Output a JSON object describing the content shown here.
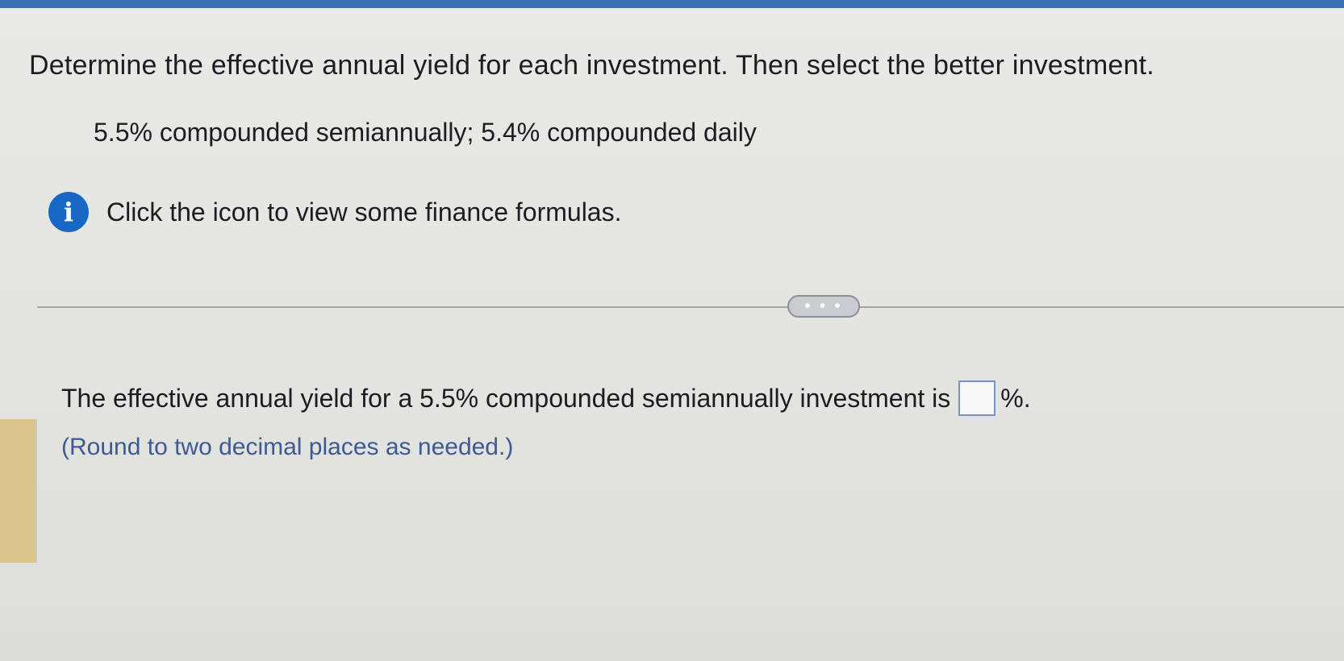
{
  "question": {
    "title": "Determine the effective annual yield for each investment. Then select the better investment.",
    "problem": "5.5% compounded semiannually; 5.4% compounded daily",
    "info_text": "Click the icon to view some finance formulas.",
    "info_icon_glyph": "i"
  },
  "divider": {
    "expand_label": "• • •"
  },
  "answer": {
    "prompt_before": "The effective annual yield for a 5.5% compounded semiannually investment is",
    "prompt_after": "%.",
    "input_value": "",
    "note": "(Round to two decimal places as needed.)"
  },
  "colors": {
    "accent_blue": "#1767c4",
    "note_blue": "#3e5a95",
    "left_accent": "#dcc48d"
  },
  "icons": [
    "info-icon"
  ]
}
